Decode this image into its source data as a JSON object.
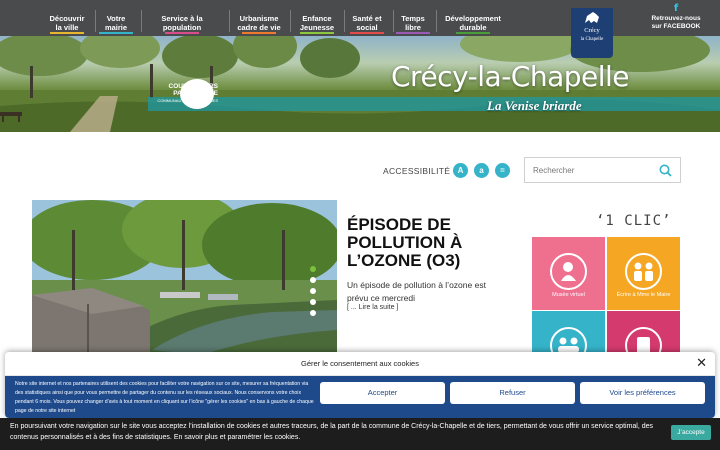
{
  "nav": {
    "items": [
      {
        "l1": "Découvrir",
        "l2": "la ville",
        "color": "#e8b730"
      },
      {
        "l1": "Votre",
        "l2": "mairie",
        "color": "#35b3c9"
      },
      {
        "l1": "Service à la",
        "l2": "population",
        "color": "#d94e8a"
      },
      {
        "l1": "Urbanisme",
        "l2": "cadre de vie",
        "color": "#f07a2c"
      },
      {
        "l1": "Enfance",
        "l2": "Jeunesse",
        "color": "#8cc63f"
      },
      {
        "l1": "Santé et",
        "l2": "social",
        "color": "#e24b4b"
      },
      {
        "l1": "Temps",
        "l2": "libre",
        "color": "#9b59b6"
      },
      {
        "l1": "Développement",
        "l2": "durable",
        "color": "#4a9e3a"
      }
    ],
    "logo_line1": "Crécy",
    "logo_line2": "la Chapelle",
    "facebook_l1": "Retrouvez-nous",
    "facebook_l2": "sur FACEBOOK",
    "facebook_icon": "facebook-icon"
  },
  "hero": {
    "title": "Crécy-la-Chapelle",
    "subtitle": "La Venise briarde",
    "partner_l1": "COULOMMIERS",
    "partner_l2": "PAYS DE BRIE",
    "partner_l3": "COMMUNAUTÉ DE COMMUNES"
  },
  "toolbar": {
    "accessibility_label": "ACCESSIBILITÉ",
    "font_buttons": [
      "A",
      "a",
      "="
    ],
    "search_placeholder": "Rechercher",
    "search_icon": "search-icon"
  },
  "news": {
    "title": "ÉPISODE DE POLLUTION À L’OZONE (O3)",
    "text": "Un épisode de pollution à l’ozone est prévu ce mercredi",
    "more": "[ ... Lire la suite ]",
    "slide_count": 5,
    "active_slide": 1
  },
  "quick": {
    "title": "‘1 CLIC’",
    "tiles": [
      {
        "label": "Musée virtuel",
        "color": "#ef6f8f",
        "icon": "museum-icon"
      },
      {
        "label": "Écrire à Mme le Maire",
        "color": "#f5a623",
        "icon": "mayor-icon"
      },
      {
        "label": "",
        "color": "#35b3c9",
        "icon": "people-icon"
      },
      {
        "label": "",
        "color": "#d43a6e",
        "icon": "document-icon"
      }
    ]
  },
  "consent": {
    "title": "Gérer le consentement aux cookies",
    "text": "Notre site internet et nos partenaires utilisent des cookies pour faciliter votre navigation sur ce site, mesurer sa fréquentation via des statistiques ainsi que pour vous permettre de partager du contenu sur les réseaux sociaux. Nous conservons votre choix pendant 6 mois. Vous pouvez changer d’avis à tout moment en cliquant sur l’icône \"gérer les cookies\" en bas à gauche de chaque page de notre site internet",
    "accept": "Accepter",
    "refuse": "Refuser",
    "prefs": "Voir les préférences",
    "close_icon": "close-icon"
  },
  "cookiebar": {
    "text": "En poursuivant votre navigation sur le site vous acceptez l’installation de cookies et autres traceurs, de la part de la commune de Crécy-la-Chapelle et de tiers, permettant de vous offrir un service optimal, des contenus personnalisés et à des fins de statistiques. En savoir plus et paramétrer les cookies.",
    "accept": "J’accepte"
  }
}
